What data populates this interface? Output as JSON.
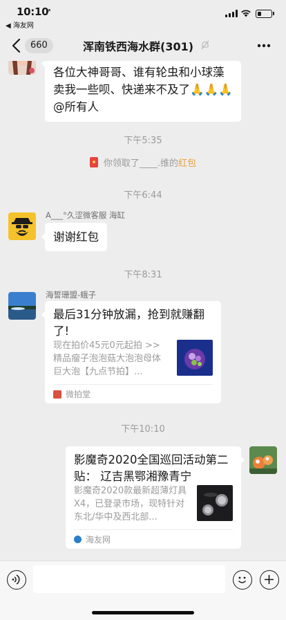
{
  "status_bar": {
    "time": "10:10",
    "back_app": "◀ 海友网",
    "battery_level": 0.3
  },
  "nav": {
    "unread_count": "660",
    "title": "浑南铁西海水群(301)"
  },
  "messages": {
    "m1_text": "各位大神哥哥、谁有轮虫和小球藻卖我一些呗、快递来不及了🙏🙏🙏@所有人",
    "ts1": "下午5:35",
    "sys_prefix": "你领取了____.维的",
    "sys_link": "红包",
    "ts2": "下午6:44",
    "m2_sender": "A___°久涩微客服 海缸",
    "m2_text": "谢谢红包",
    "ts3": "下午8:31",
    "m3_sender": "海誓珊盟-蛾子",
    "m3_title": "最后31分钟放漏，抢到就赚翻了!",
    "m3_desc": "现在拍价45元0元起拍 >> 精品瘤子泡泡菇大泡泡母体巨大泡【九点节拍】...",
    "m3_source": "微拍堂",
    "ts4": "下午10:10",
    "m4_title": "影魔奇2020全国巡回活动第二贴： 辽吉黑鄂湘豫青宁",
    "m4_desc": "影魔奇2020款最新超薄灯具X4，已登录市场，现特针对东北/华中及西北部...",
    "m4_source": "海友网"
  },
  "input": {
    "placeholder": ""
  },
  "colors": {
    "background": "#ededed",
    "bubble": "#ffffff",
    "accent_link": "#e9a13b",
    "red_packet": "#e64340"
  }
}
